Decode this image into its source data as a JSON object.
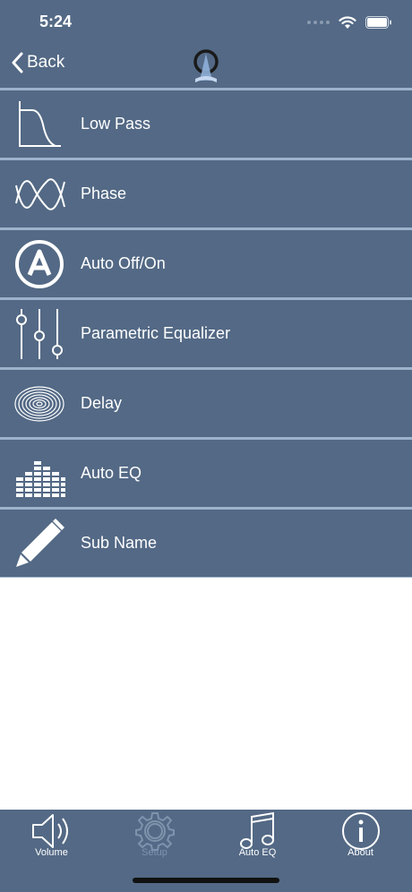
{
  "status_bar": {
    "time": "5:24"
  },
  "nav": {
    "back_label": "Back"
  },
  "menu": {
    "items": [
      {
        "label": "Low Pass",
        "icon": "low-pass-filter-icon"
      },
      {
        "label": "Phase",
        "icon": "phase-wave-icon"
      },
      {
        "label": "Auto Off/On",
        "icon": "auto-a-icon"
      },
      {
        "label": "Parametric Equalizer",
        "icon": "sliders-icon"
      },
      {
        "label": "Delay",
        "icon": "concentric-rings-icon"
      },
      {
        "label": "Auto EQ",
        "icon": "eq-bars-icon"
      },
      {
        "label": "Sub Name",
        "icon": "pencil-icon"
      }
    ]
  },
  "tabbar": {
    "tabs": [
      {
        "label": "Volume",
        "icon": "speaker-icon",
        "active": true
      },
      {
        "label": "Setup",
        "icon": "gear-icon",
        "active": false
      },
      {
        "label": "Auto EQ",
        "icon": "music-note-icon",
        "active": true
      },
      {
        "label": "About",
        "icon": "info-icon",
        "active": true
      }
    ]
  },
  "colors": {
    "bar_background": "#536985",
    "separator": "#9db3cc",
    "text": "#ffffff",
    "inactive_tab": "#7e94ad"
  }
}
